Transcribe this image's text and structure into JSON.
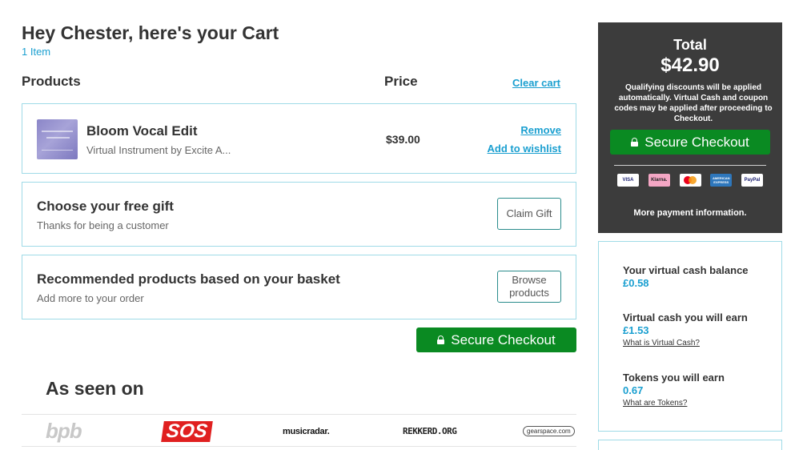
{
  "header": {
    "title": "Hey Chester, here's your Cart",
    "item_count": "1 Item"
  },
  "columns": {
    "products": "Products",
    "price": "Price",
    "clear_cart": "Clear cart"
  },
  "cart_item": {
    "name": "Bloom Vocal Edit",
    "subtitle": "Virtual Instrument by Excite A...",
    "price": "$39.00",
    "remove": "Remove",
    "wishlist": "Add to wishlist",
    "thumbnail_icon": "product-artwork-image"
  },
  "gift": {
    "heading": "Choose your free gift",
    "subtitle": "Thanks for being a customer",
    "button": "Claim Gift"
  },
  "recommended": {
    "heading": "Recommended products based on your basket",
    "subtitle": "Add more to your order",
    "button": "Browse products"
  },
  "checkout": {
    "label": "Secure Checkout",
    "icon": "lock-icon",
    "color": "#0a8a22"
  },
  "as_seen_on": {
    "title": "As seen on",
    "logos": [
      "bpb",
      "SOS",
      "musicradar.",
      "REKKERD.ORG",
      "gearspace.com"
    ]
  },
  "summary": {
    "total_label": "Total",
    "total_amount": "$42.90",
    "note": "Qualifying discounts will be applied automatically. Virtual Cash and coupon codes may be applied after proceeding to Checkout.",
    "checkout_label": "Secure Checkout",
    "payment_methods": [
      "VISA",
      "Klarna.",
      "Mastercard",
      "AMERICAN EXPRESS",
      "PayPal"
    ],
    "more_payment": "More payment information."
  },
  "virtual_cash": {
    "balance_label": "Your virtual cash balance",
    "balance_value": "£0.58",
    "earn_label": "Virtual cash you will earn",
    "earn_value": "£1.53",
    "earn_link": "What is Virtual Cash?",
    "tokens_label": "Tokens you will earn",
    "tokens_value": "0.67",
    "tokens_link": "What are Tokens?"
  },
  "colors": {
    "accent_link": "#1a9fd0",
    "panel_dark": "#3c3c3c",
    "border": "#9fdbe7"
  }
}
